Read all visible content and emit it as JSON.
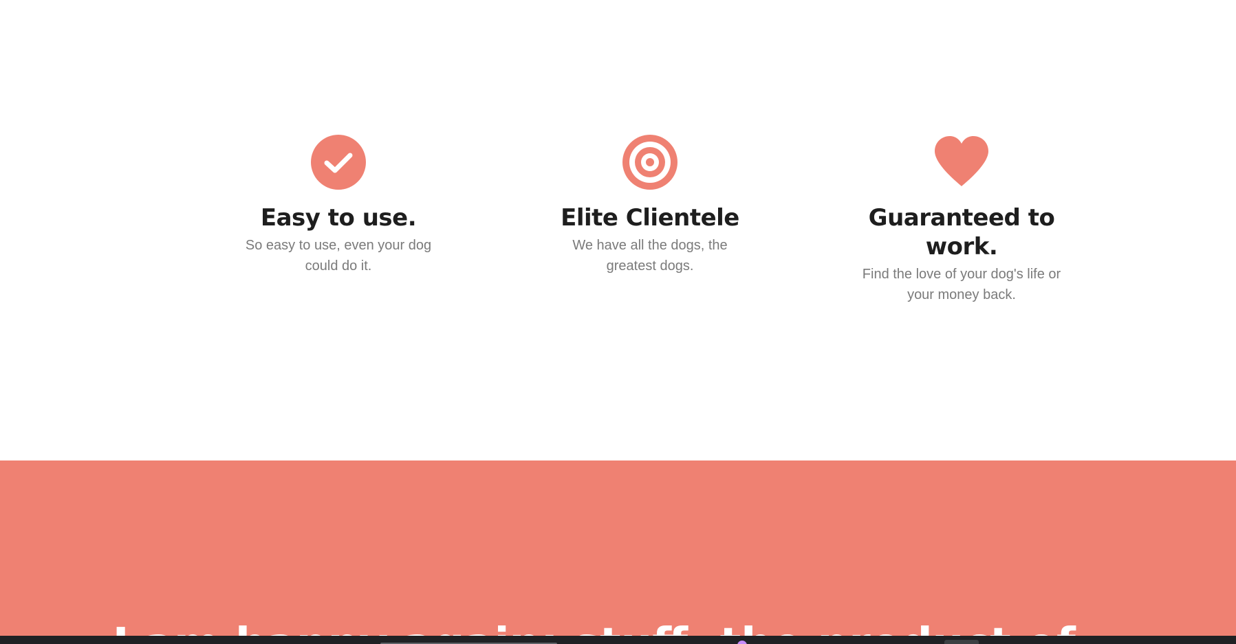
{
  "colors": {
    "accent": "#ef8172",
    "heading": "#1e1e1e",
    "body_text": "#7a7a7a",
    "taskbar": "#202124"
  },
  "features": [
    {
      "icon": "check-circle-icon",
      "title": "Easy to use.",
      "description": "So easy to use, even your dog could do it."
    },
    {
      "icon": "bullseye-icon",
      "title": "Elite Clientele",
      "description": "We have all the dogs, the greatest dogs."
    },
    {
      "icon": "heart-icon",
      "title": "Guaranteed to work.",
      "description": "Find the love of your dog's life or your money back."
    }
  ],
  "cta": {
    "heading": "I am happy again: stuff, the product of..."
  }
}
